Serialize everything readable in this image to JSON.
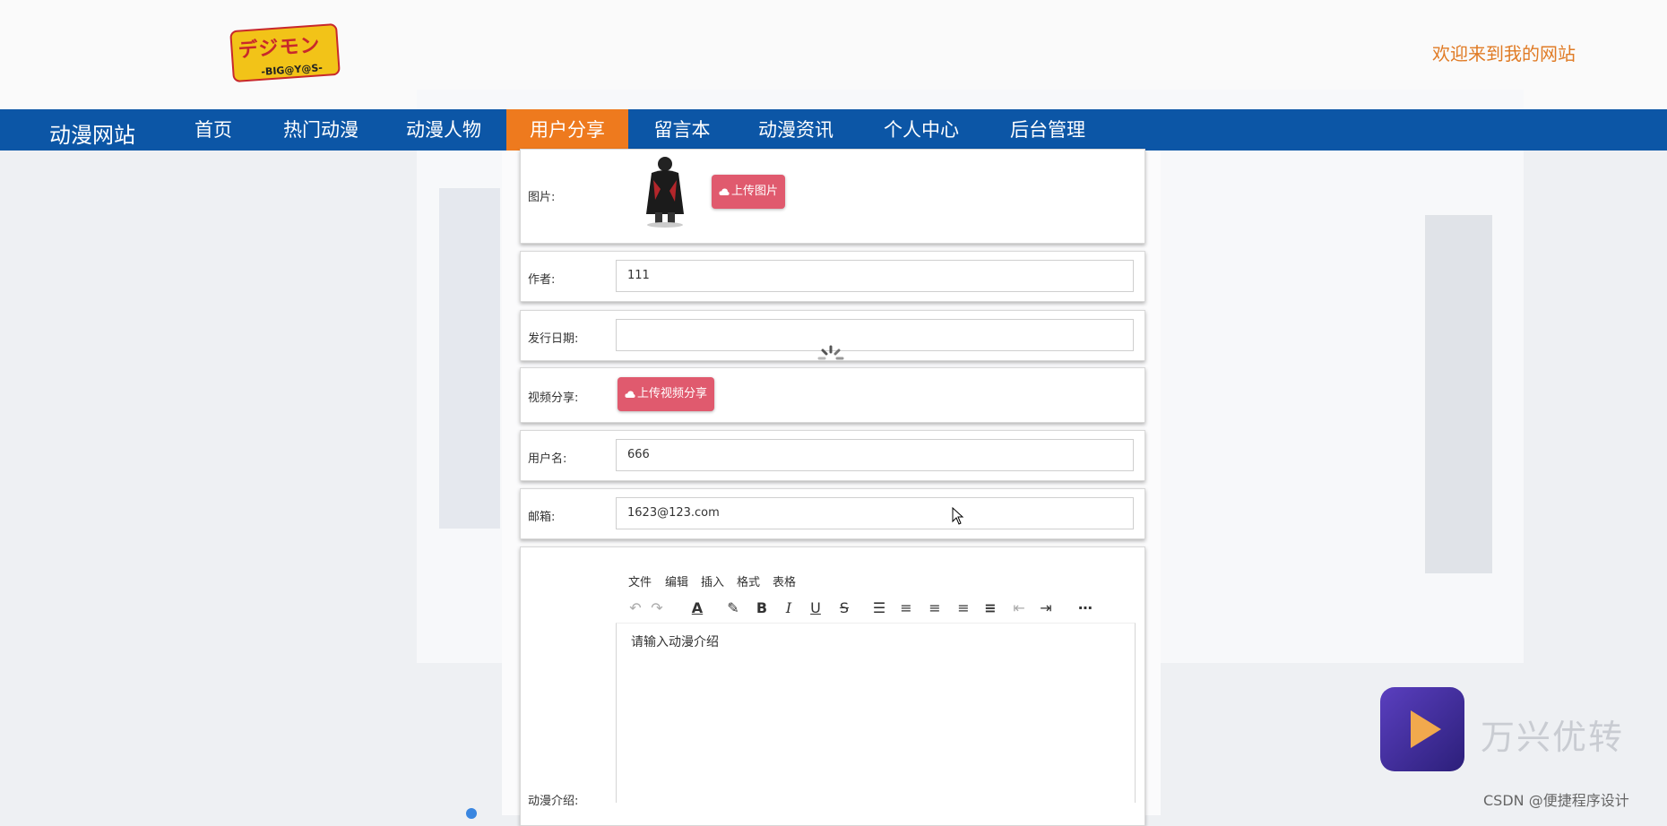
{
  "header": {
    "logo": {
      "glyph": "デジモン",
      "sub": "-BIG@Y@S-"
    },
    "welcome": "欢迎来到我的网站"
  },
  "nav": {
    "brand": "动漫网站",
    "items": [
      "首页",
      "热门动漫",
      "动漫人物",
      "用户分享",
      "留言本",
      "动漫资讯",
      "个人中心",
      "后台管理"
    ],
    "active_index": 3
  },
  "form": {
    "image": {
      "label": "图片:",
      "button": "上传图片"
    },
    "author": {
      "label": "作者:",
      "value": "111"
    },
    "release_date": {
      "label": "发行日期:",
      "value": ""
    },
    "video": {
      "label": "视频分享:",
      "button": "上传视频分享"
    },
    "username": {
      "label": "用户名:",
      "value": "666"
    },
    "email": {
      "label": "邮箱:",
      "value": "1623@123.com"
    },
    "intro": {
      "label": "动漫介绍:",
      "menu": [
        "文件",
        "编辑",
        "插入",
        "格式",
        "表格"
      ],
      "placeholder": "请输入动漫介绍"
    }
  },
  "toolbar_icons": [
    "undo-icon",
    "redo-icon",
    "font-color-icon",
    "highlight-icon",
    "bold-icon",
    "italic-icon",
    "underline-icon",
    "strikethrough-icon",
    "line-height-icon",
    "align-left-icon",
    "align-center-icon",
    "align-right-icon",
    "align-justify-icon",
    "outdent-icon",
    "indent-icon",
    "more-icon"
  ],
  "watermark": {
    "text": "万兴优转",
    "credit": "CSDN @便捷程序设计"
  },
  "colors": {
    "nav": "#0c56a6",
    "active": "#ee7a1e",
    "welcome": "#e07b25",
    "upload_button": "#e05a6e"
  }
}
